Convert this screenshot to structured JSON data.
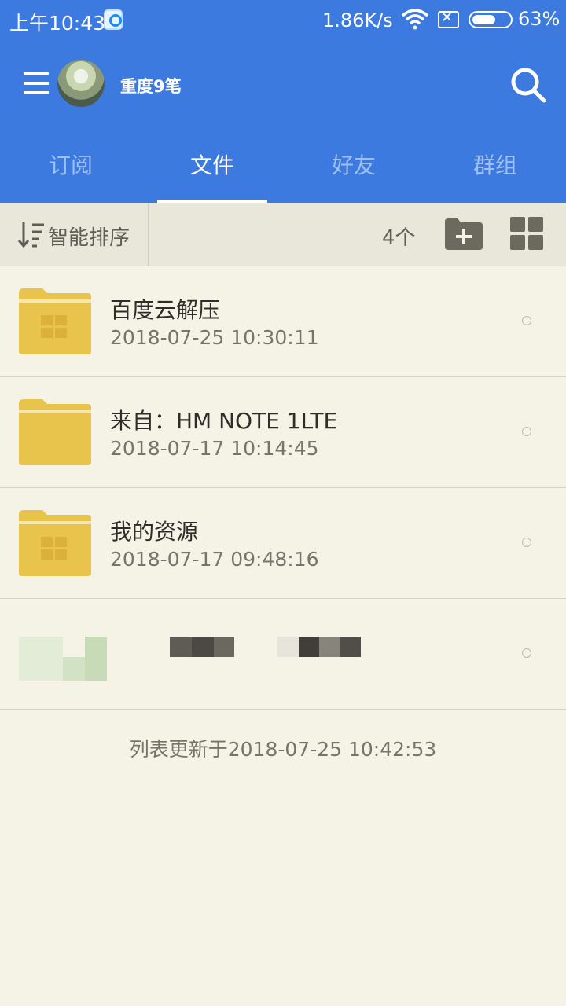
{
  "status_bar": {
    "time": "上午10:43",
    "net_speed": "1.86K/s",
    "sim_mark": "✕",
    "battery": "63%",
    "battery_level": 0.63
  },
  "toolbar": {
    "username": "重度9笔",
    "menu_icon": "hamburger-icon",
    "search_icon": "search-icon"
  },
  "tabs": [
    {
      "label": "订阅",
      "active": false
    },
    {
      "label": "文件",
      "active": true
    },
    {
      "label": "好友",
      "active": false
    },
    {
      "label": "群组",
      "active": false
    }
  ],
  "sortbar": {
    "sort_label": "智能排序",
    "count": "4个",
    "new_folder_icon": "new-folder-icon",
    "grid_icon": "grid-view-icon"
  },
  "files": [
    {
      "name": "百度云解压",
      "date": "2018-07-25 10:30:11"
    },
    {
      "name": "来自：HM NOTE 1LTE",
      "date": "2018-07-17 10:14:45"
    },
    {
      "name": "我的资源",
      "date": "2018-07-17 09:48:16"
    }
  ],
  "footer": {
    "updated": "列表更新于2018-07-25 10:42:53"
  },
  "colors": {
    "header": "#3c7ae0",
    "background": "#f4f3e6",
    "folder": "#e9c44c"
  }
}
